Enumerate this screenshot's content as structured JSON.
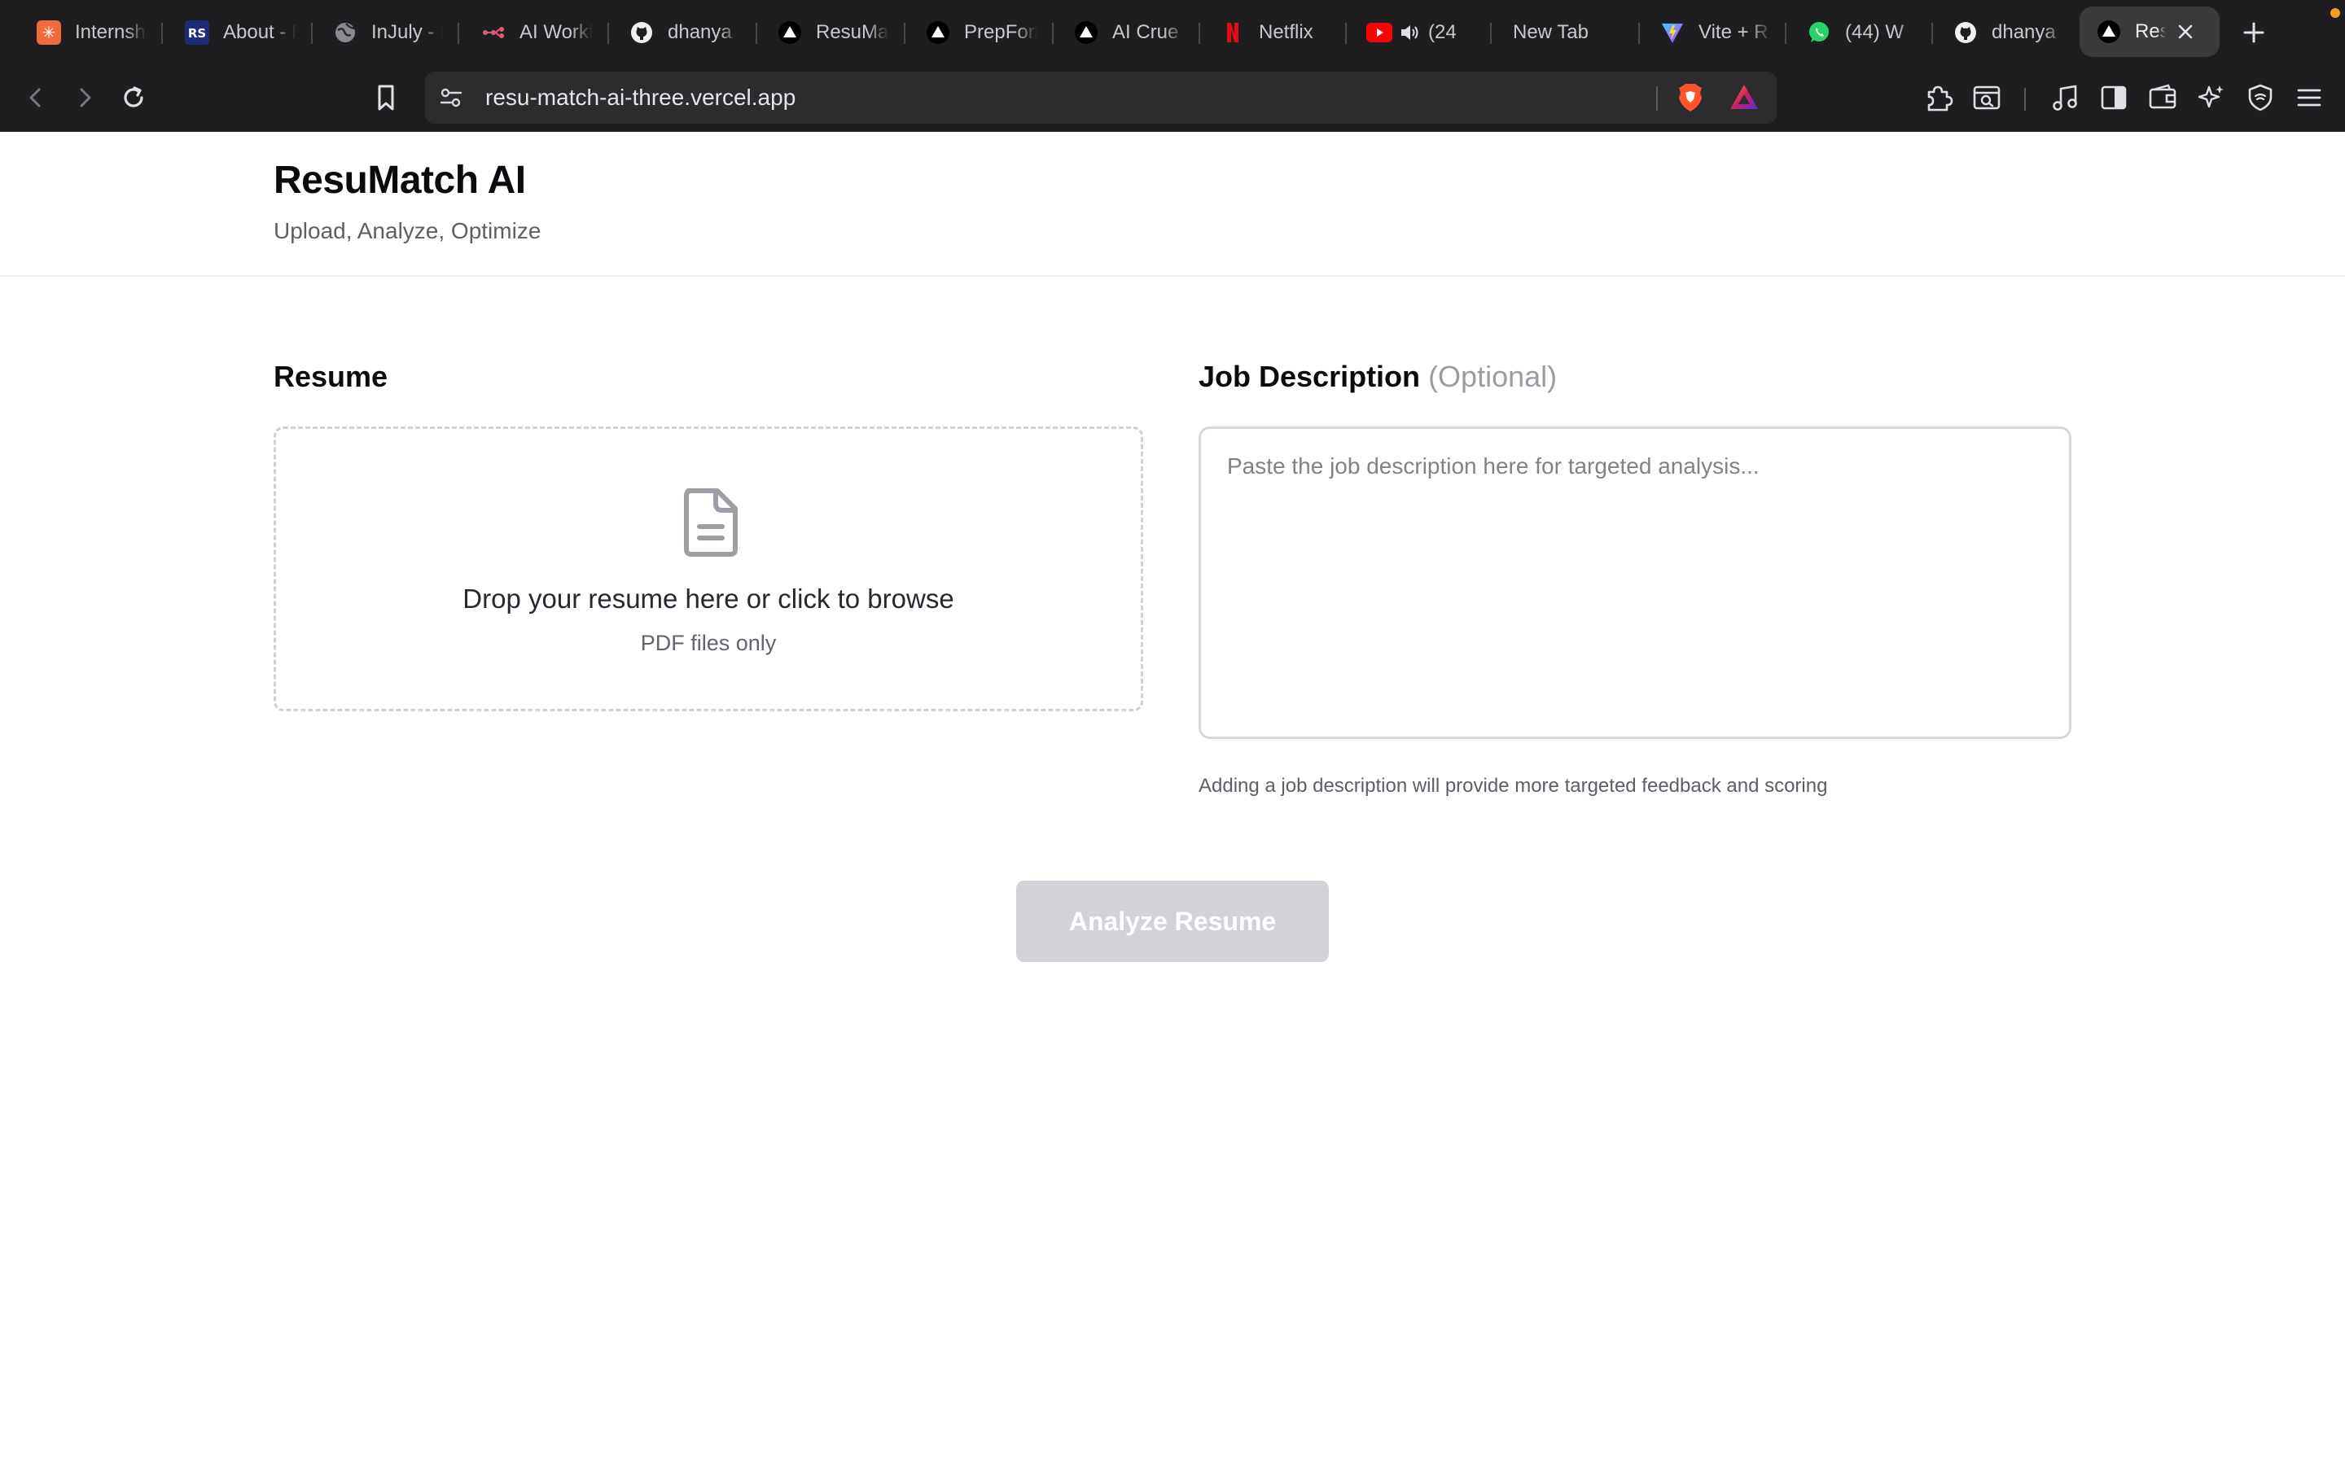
{
  "browser": {
    "tabs": [
      {
        "label": "Internships",
        "icon": "orange-asterisk-icon"
      },
      {
        "label": "About - RS",
        "icon": "rs-logo-icon"
      },
      {
        "label": "InJuly - Home",
        "icon": "globe-icon"
      },
      {
        "label": "AI Workflow",
        "icon": "workflow-icon"
      },
      {
        "label": "dhanya",
        "icon": "github-icon"
      },
      {
        "label": "ResuMatch",
        "icon": "vercel-icon"
      },
      {
        "label": "PrepForge",
        "icon": "vercel-icon"
      },
      {
        "label": "AI Crue",
        "icon": "vercel-icon"
      },
      {
        "label": "Netflix",
        "icon": "netflix-icon"
      },
      {
        "label": "(24",
        "icon": "youtube-icon",
        "audio": true
      },
      {
        "label": "New Tab",
        "icon": ""
      },
      {
        "label": "Vite + R",
        "icon": "vite-icon"
      },
      {
        "label": "(44) W",
        "icon": "whatsapp-icon"
      },
      {
        "label": "dhanya",
        "icon": "github-icon"
      },
      {
        "label": "Res",
        "icon": "vercel-icon",
        "active": true
      }
    ],
    "url": "resu-match-ai-three.vercel.app"
  },
  "app": {
    "title": "ResuMatch AI",
    "subtitle": "Upload, Analyze, Optimize"
  },
  "resume": {
    "label": "Resume",
    "drop_title": "Drop your resume here or click to browse",
    "drop_sub": "PDF files only"
  },
  "job": {
    "label": "Job Description",
    "optional": "(Optional)",
    "placeholder": "Paste the job description here for targeted analysis...",
    "help": "Adding a job description will provide more targeted feedback and scoring"
  },
  "actions": {
    "analyze_label": "Analyze Resume"
  },
  "colors": {
    "accent_disabled": "#d1d3d8",
    "brave_orange": "#fb542b"
  }
}
